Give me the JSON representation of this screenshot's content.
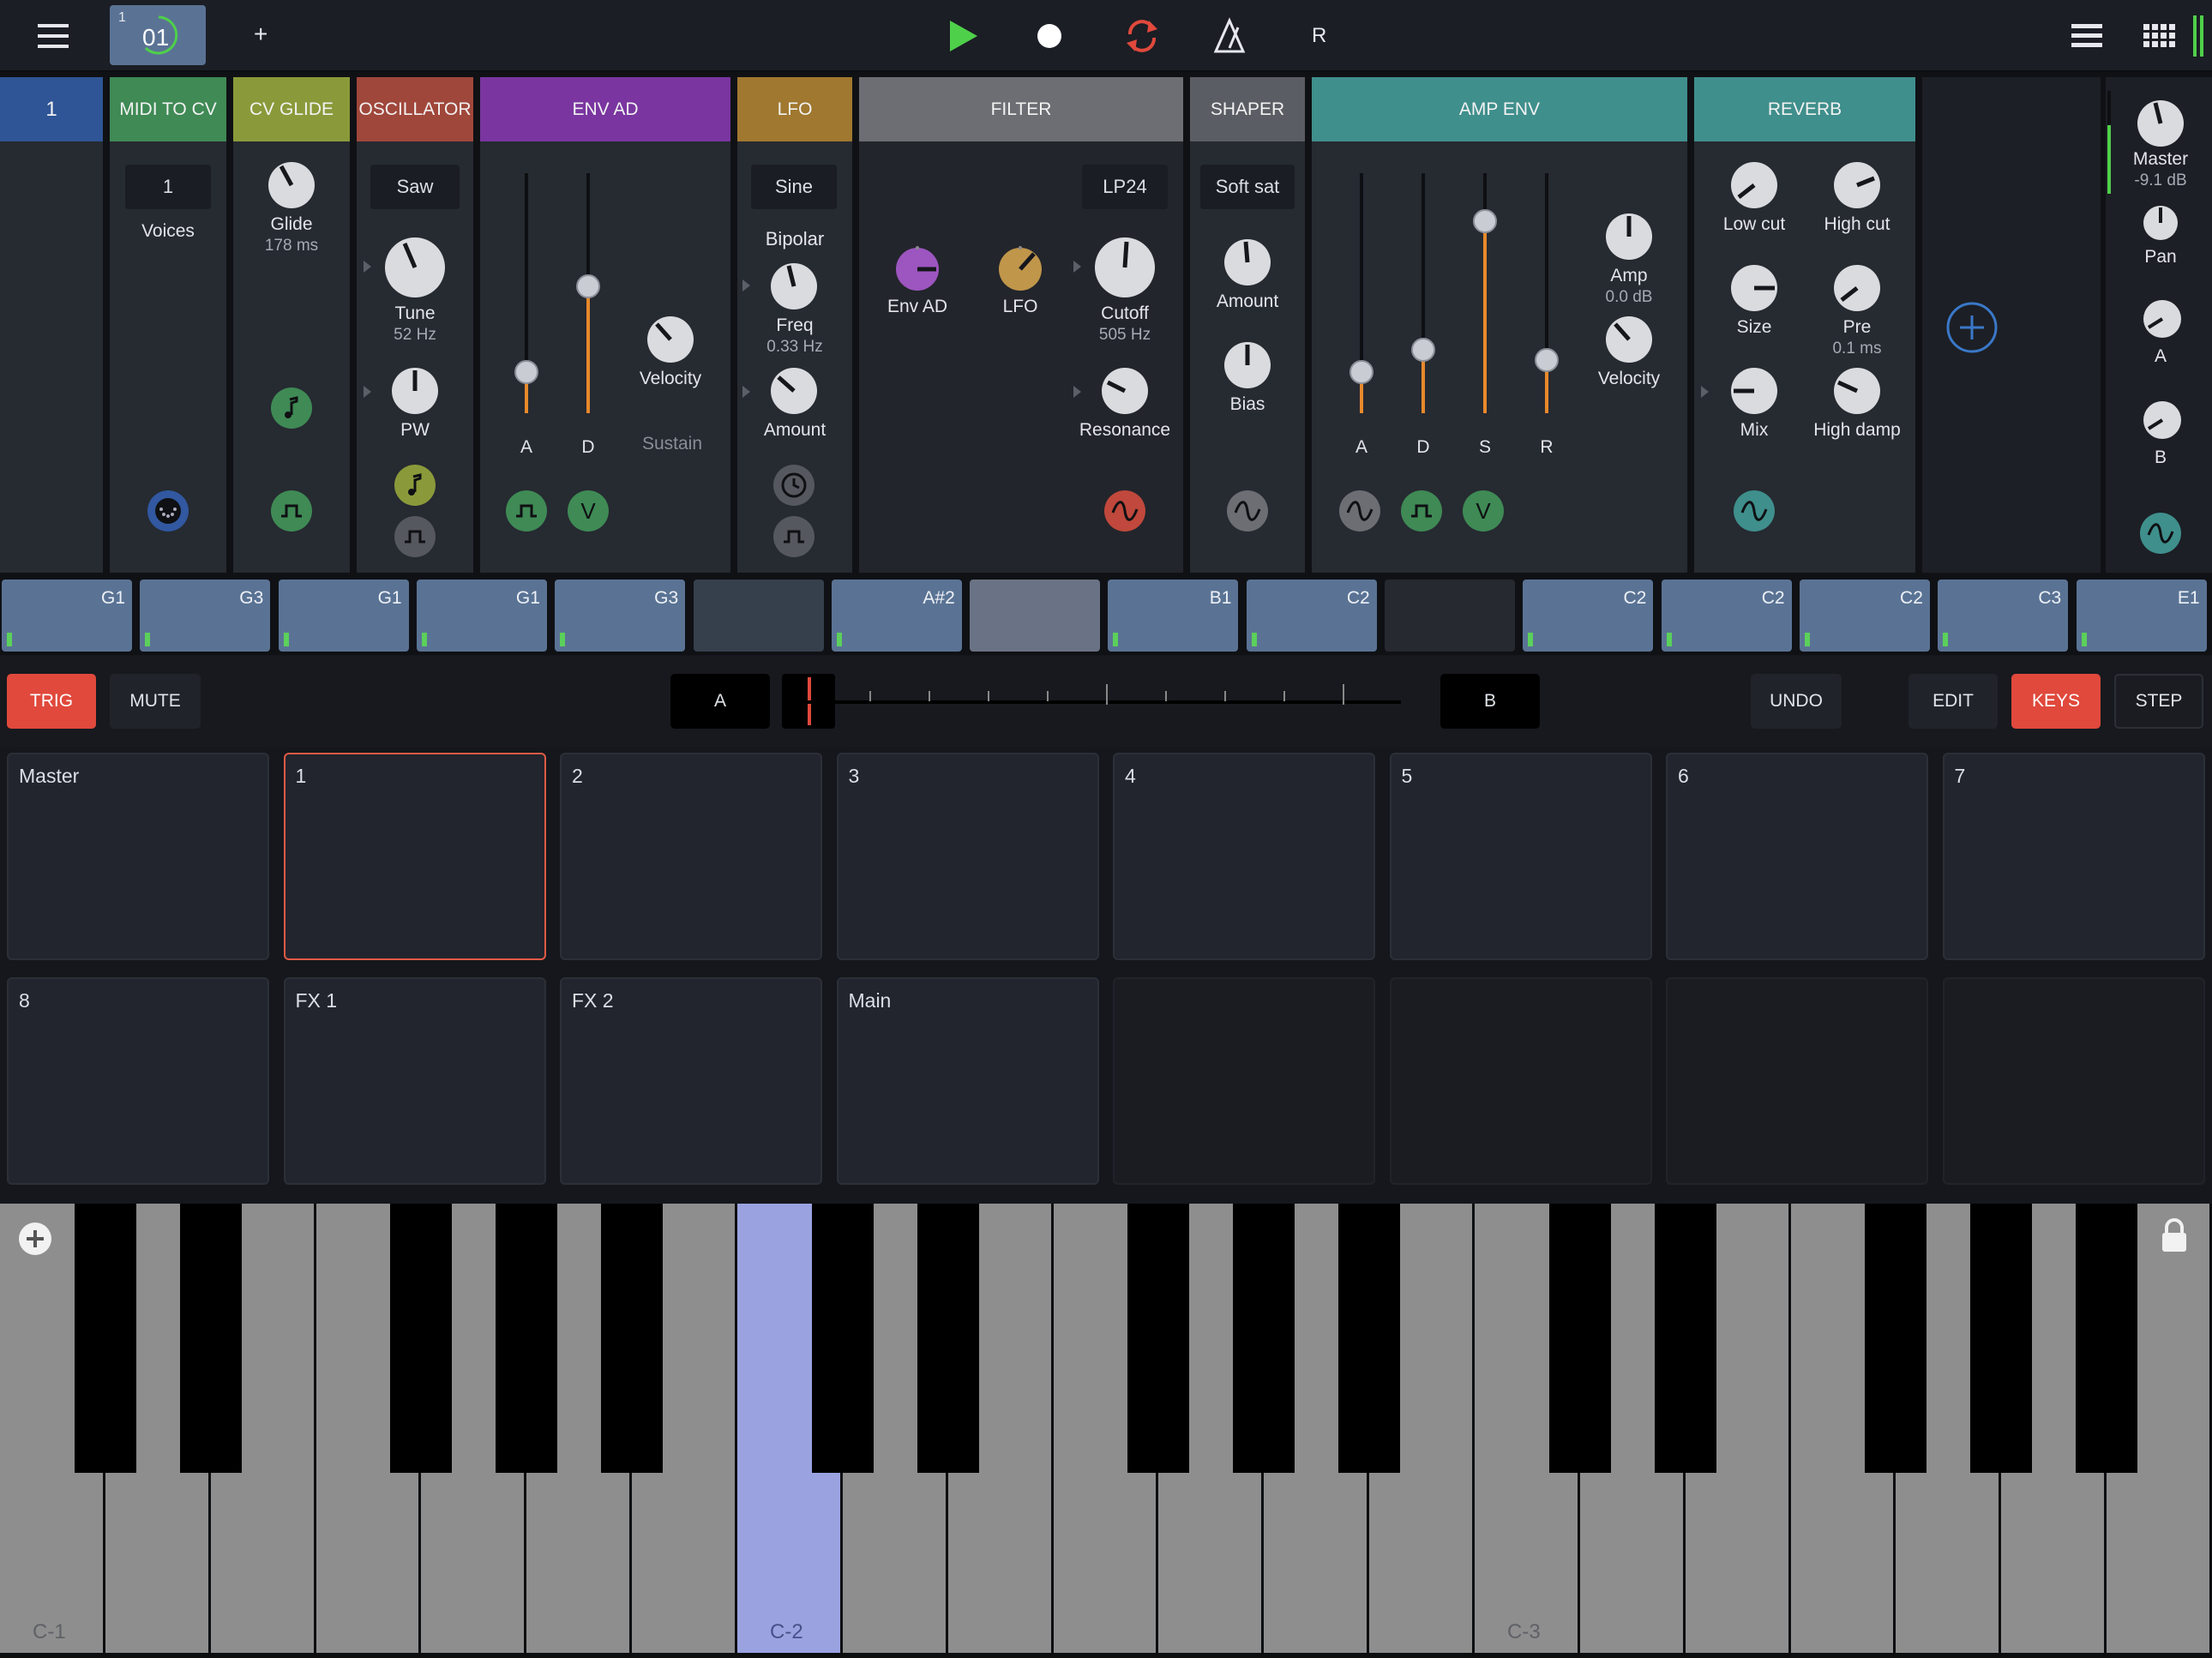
{
  "topbar": {
    "menu_icon": "hamburger-icon",
    "project_small": "1",
    "project_number": "01",
    "add_label": "+",
    "play_icon": "play-icon",
    "record_icon": "record-icon",
    "loop_icon": "loop-icon",
    "metronome_icon": "metronome-icon",
    "r_label": "R",
    "list_icon": "list-icon",
    "grid_icon": "grid-icon",
    "colors": {
      "play": "#4fd04a",
      "loop": "#e0493c",
      "project": "#5a7394"
    }
  },
  "modules": {
    "track": {
      "title": "1"
    },
    "midi_to_cv": {
      "title": "MIDI TO CV",
      "voices_value": "1",
      "voices_label": "Voices"
    },
    "cv_glide": {
      "title": "CV GLIDE",
      "glide_label": "Glide",
      "glide_value": "178 ms"
    },
    "oscillator": {
      "title": "OSCILLATOR",
      "wave": "Saw",
      "tune_label": "Tune",
      "tune_value": "52 Hz",
      "pw_label": "PW"
    },
    "env_ad": {
      "title": "ENV AD",
      "a_label": "A",
      "d_label": "D",
      "velocity_label": "Velocity",
      "sustain_label": "Sustain",
      "v_label": "V"
    },
    "lfo": {
      "title": "LFO",
      "wave": "Sine",
      "mode": "Bipolar",
      "freq_label": "Freq",
      "freq_value": "0.33 Hz",
      "amount_label": "Amount"
    },
    "filter": {
      "title": "FILTER",
      "type": "LP24",
      "env_label": "Env AD",
      "lfo_label": "LFO",
      "cutoff_label": "Cutoff",
      "cutoff_value": "505 Hz",
      "resonance_label": "Resonance"
    },
    "shaper": {
      "title": "SHAPER",
      "type": "Soft sat",
      "amount_label": "Amount",
      "bias_label": "Bias"
    },
    "amp_env": {
      "title": "AMP ENV",
      "a_label": "A",
      "d_label": "D",
      "s_label": "S",
      "r_label": "R",
      "amp_label": "Amp",
      "amp_value": "0.0 dB",
      "velocity_label": "Velocity",
      "v_label": "V"
    },
    "reverb": {
      "title": "REVERB",
      "lowcut_label": "Low cut",
      "highcut_label": "High cut",
      "size_label": "Size",
      "pre_label": "Pre",
      "pre_value": "0.1 ms",
      "mix_label": "Mix",
      "highdamp_label": "High damp"
    },
    "mixer": {
      "master_label": "Master",
      "master_value": "-9.1 dB",
      "pan_label": "Pan",
      "a_label": "A",
      "b_label": "B"
    }
  },
  "patterns": [
    "G1",
    "G3",
    "G1",
    "G1",
    "G3",
    "",
    "A#2",
    "",
    "B1",
    "C2",
    "",
    "C2",
    "C2",
    "C2",
    "C3",
    "E1"
  ],
  "controls": {
    "trig": "TRIG",
    "mute": "MUTE",
    "a": "A",
    "b": "B",
    "undo": "UNDO",
    "edit": "EDIT",
    "keys": "KEYS",
    "step": "STEP"
  },
  "pads": [
    "Master",
    "1",
    "2",
    "3",
    "4",
    "5",
    "6",
    "7",
    "8",
    "FX 1",
    "FX 2",
    "Main",
    "",
    "",
    "",
    ""
  ],
  "keyboard": {
    "labels": [
      "C-1",
      "C-2",
      "C-3"
    ],
    "add_icon": "plus-circle-icon",
    "lock_icon": "lock-icon"
  }
}
